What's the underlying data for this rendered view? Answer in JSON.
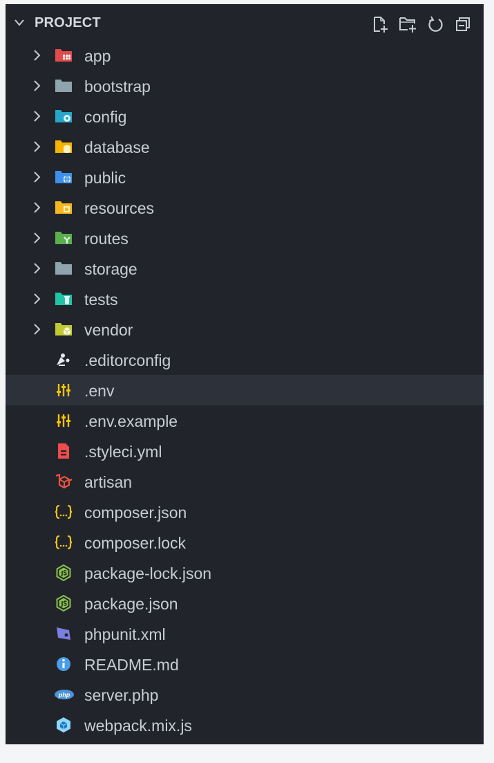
{
  "explorer": {
    "title": "PROJECT",
    "actions": [
      {
        "name": "new-file-icon"
      },
      {
        "name": "new-folder-icon"
      },
      {
        "name": "refresh-icon"
      },
      {
        "name": "collapse-all-icon"
      }
    ]
  },
  "tree": {
    "folders": [
      {
        "label": "app",
        "icon": "folder-app-icon",
        "color": "#e24b4b"
      },
      {
        "label": "bootstrap",
        "icon": "folder-icon",
        "color": "#90a4ae"
      },
      {
        "label": "config",
        "icon": "folder-config-icon",
        "color": "#26a6c8"
      },
      {
        "label": "database",
        "icon": "folder-database-icon",
        "color": "#f4b400"
      },
      {
        "label": "public",
        "icon": "folder-public-icon",
        "color": "#3d8fe8"
      },
      {
        "label": "resources",
        "icon": "folder-resources-icon",
        "color": "#f5b820"
      },
      {
        "label": "routes",
        "icon": "folder-routes-icon",
        "color": "#5aaf4c"
      },
      {
        "label": "storage",
        "icon": "folder-icon",
        "color": "#90a4ae"
      },
      {
        "label": "tests",
        "icon": "folder-tests-icon",
        "color": "#1fc4a6"
      },
      {
        "label": "vendor",
        "icon": "folder-vendor-icon",
        "color": "#c0ca33"
      }
    ],
    "files": [
      {
        "label": ".editorconfig",
        "icon": "editorconfig-icon",
        "color": "#e8eaed"
      },
      {
        "label": ".env",
        "icon": "env-tune-icon",
        "color": "#f4c20d",
        "selected": true
      },
      {
        "label": ".env.example",
        "icon": "env-tune-icon",
        "color": "#f4c20d"
      },
      {
        "label": ".styleci.yml",
        "icon": "yaml-icon",
        "color": "#ef4b4b"
      },
      {
        "label": "artisan",
        "icon": "laravel-icon",
        "color": "#f05340"
      },
      {
        "label": "composer.json",
        "icon": "json-braces-icon",
        "color": "#f5c21b"
      },
      {
        "label": "composer.lock",
        "icon": "json-braces-icon",
        "color": "#f5c21b"
      },
      {
        "label": "package-lock.json",
        "icon": "nodejs-icon",
        "color": "#8bc34a"
      },
      {
        "label": "package.json",
        "icon": "nodejs-icon",
        "color": "#8bc34a"
      },
      {
        "label": "phpunit.xml",
        "icon": "phpunit-icon",
        "color": "#7b7fe0"
      },
      {
        "label": "README.md",
        "icon": "info-icon",
        "color": "#4a9de8"
      },
      {
        "label": "server.php",
        "icon": "php-icon",
        "color": "#4b95d9"
      },
      {
        "label": "webpack.mix.js",
        "icon": "webpack-icon",
        "color": "#8ed6fb"
      }
    ]
  }
}
